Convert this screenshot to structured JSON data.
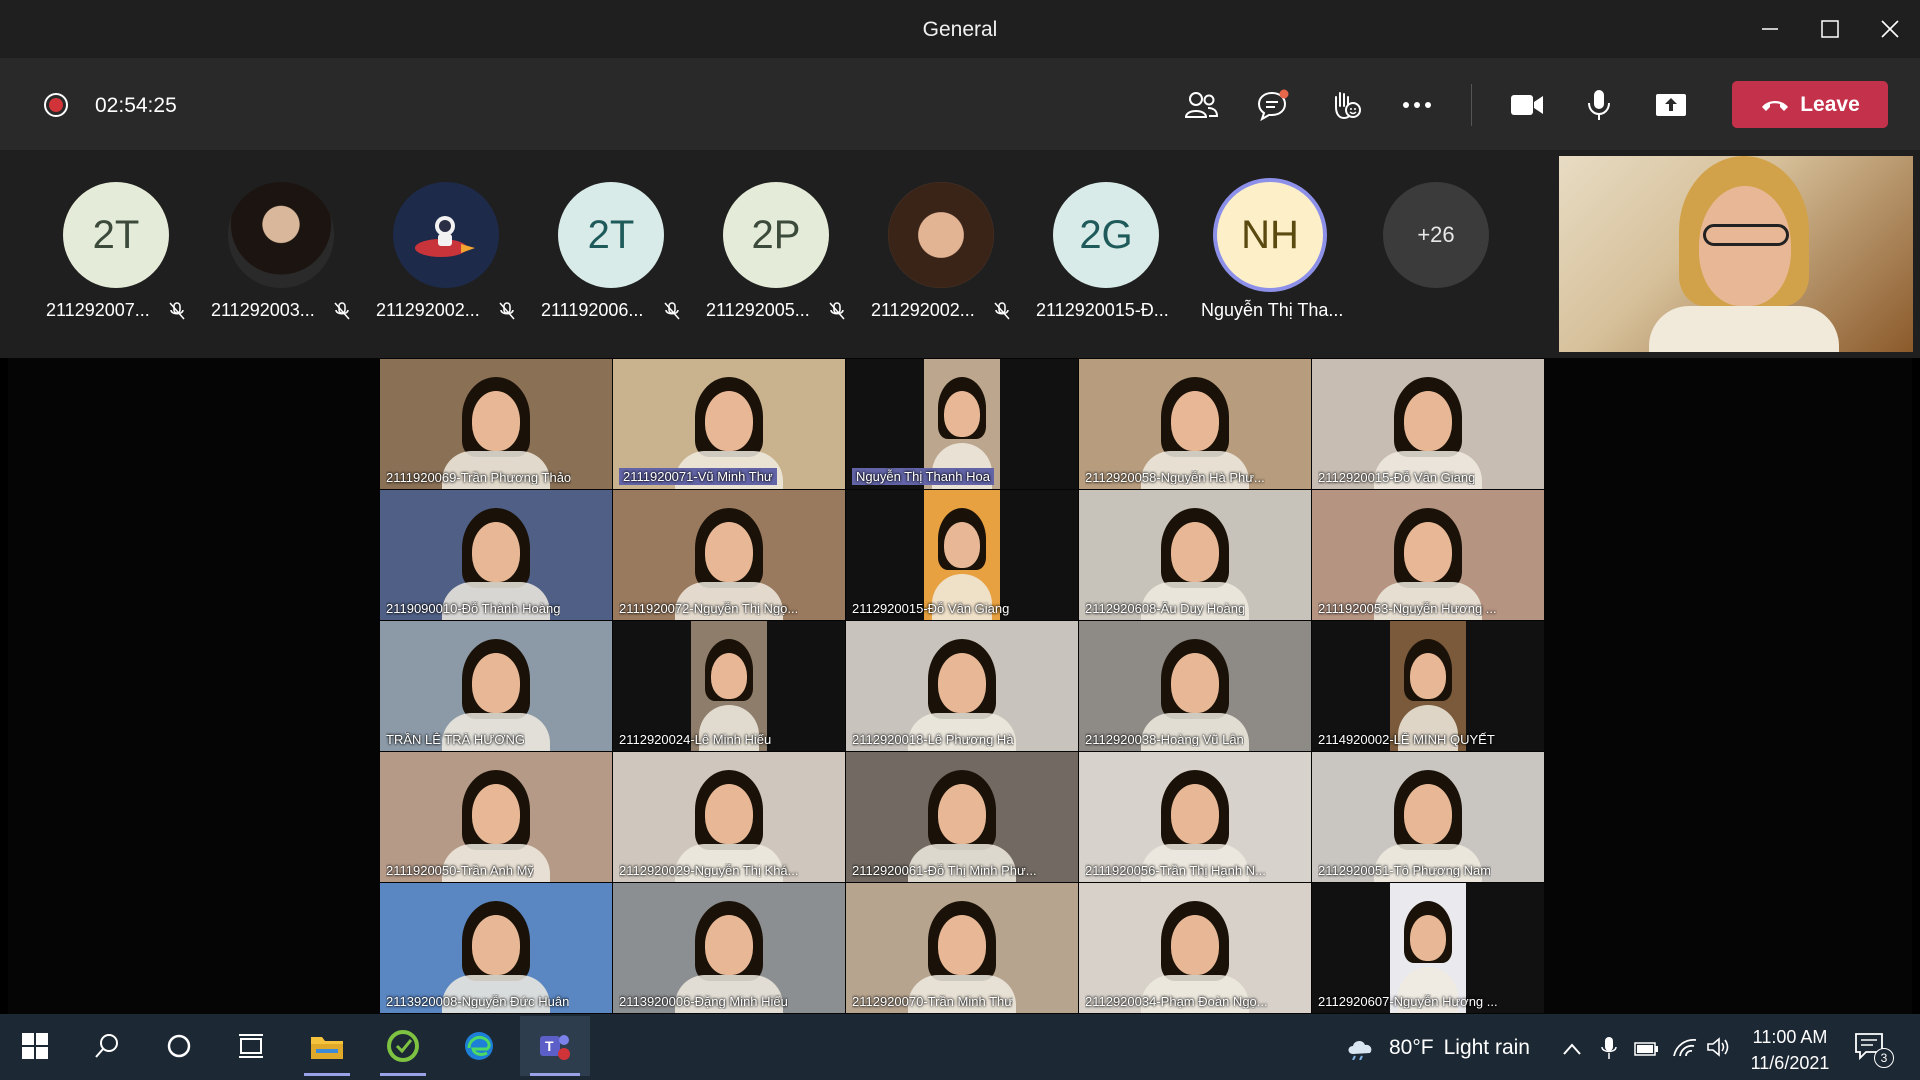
{
  "window": {
    "title": "General"
  },
  "meeting": {
    "recording_time": "02:54:25",
    "leave_label": "Leave"
  },
  "participants_strip": [
    {
      "initials": "2T",
      "name": "211292007...",
      "style": "light",
      "muted": true
    },
    {
      "initials": "",
      "name": "211292003...",
      "style": "photo",
      "muted": true
    },
    {
      "initials": "",
      "name": "211292002...",
      "style": "rocket",
      "muted": true
    },
    {
      "initials": "2T",
      "name": "211192006...",
      "style": "teal",
      "muted": true
    },
    {
      "initials": "2P",
      "name": "211292005...",
      "style": "light",
      "muted": true
    },
    {
      "initials": "",
      "name": "211292002...",
      "style": "photo",
      "muted": true
    },
    {
      "initials": "2G",
      "name": "2112920015-Đ...",
      "style": "teal",
      "muted": false
    },
    {
      "initials": "NH",
      "name": "Nguyễn Thị Tha...",
      "style": "nh",
      "muted": false
    },
    {
      "initials": "+26",
      "name": "",
      "style": "more",
      "muted": false
    }
  ],
  "grid": [
    {
      "label": "2111920069-Trần Phương Thảo",
      "bg": "#8a7055"
    },
    {
      "label": "2111920071-Vũ Minh Thư",
      "bg": "#c9b28e",
      "highlight": true
    },
    {
      "label": "Nguyễn Thị Thanh Hoa",
      "bg": "#111",
      "highlight": true,
      "narrow": true
    },
    {
      "label": "2112920058-Nguyễn Hà Phư...",
      "bg": "#b79c7d"
    },
    {
      "label": "2112920015-Đỗ Vân Giang",
      "bg": "#c8bdb3"
    },
    {
      "label": "2119090010-Đỗ Thành Hoàng",
      "bg": "#4f5f86"
    },
    {
      "label": "2111920072-Nguyễn Thị Ngọ...",
      "bg": "#9a7a5e"
    },
    {
      "label": "2112920015-Đỗ Vân Giang",
      "bg": "#111",
      "narrow": true,
      "inner": "#e7a140"
    },
    {
      "label": "2112920608-Âu Duy Hoàng",
      "bg": "#c7c2ba"
    },
    {
      "label": "2111920053-Nguyễn Hương ...",
      "bg": "#b69482"
    },
    {
      "label": "TRẦN LÊ TRÀ HƯƠNG",
      "bg": "#8c9aa8"
    },
    {
      "label": "2112920024-Lê Minh Hiếu",
      "bg": "#111",
      "narrow": true,
      "inner": "#8e7d6a"
    },
    {
      "label": "2112920018-Lê Phương Hà",
      "bg": "#c9c3bd"
    },
    {
      "label": "2112920038-Hoàng Vũ Lân",
      "bg": "#8e8a86"
    },
    {
      "label": "2114920002-LÊ MINH QUYẾT",
      "bg": "#111",
      "narrow": true,
      "inner": "#7a5a3a"
    },
    {
      "label": "2111920050-Trần Anh Mỹ",
      "bg": "#b59a88"
    },
    {
      "label": "2112920029-Nguyễn Thị Khá...",
      "bg": "#cfc7bd"
    },
    {
      "label": "2112920061-Đỗ Thị Minh Phư...",
      "bg": "#726a62"
    },
    {
      "label": "2111920056-Trần Thị Hạnh N...",
      "bg": "#d8d2cc"
    },
    {
      "label": "2112920051-Tô Phương Nam",
      "bg": "#c9c6c2"
    },
    {
      "label": "2113920008-Nguyễn Đức Huân",
      "bg": "#5a86c2"
    },
    {
      "label": "2113920006-Đặng Minh Hiếu",
      "bg": "#8c8f92"
    },
    {
      "label": "2112920070-Trần Minh Thư",
      "bg": "#b7a48f"
    },
    {
      "label": "2112920034-Phạm Đoàn Ngọ...",
      "bg": "#d7d1ca"
    },
    {
      "label": "2112920607-Nguyễn Hương ...",
      "bg": "#111",
      "narrow": true,
      "inner": "#e9e9ee"
    }
  ],
  "taskbar": {
    "weather_temp": "80°F",
    "weather_text": "Light rain",
    "time": "11:00 AM",
    "date": "11/6/2021",
    "notifications": "3"
  },
  "colors": {
    "leave": "#c4314b",
    "accent": "#6264a7",
    "recording": "#d13438"
  }
}
